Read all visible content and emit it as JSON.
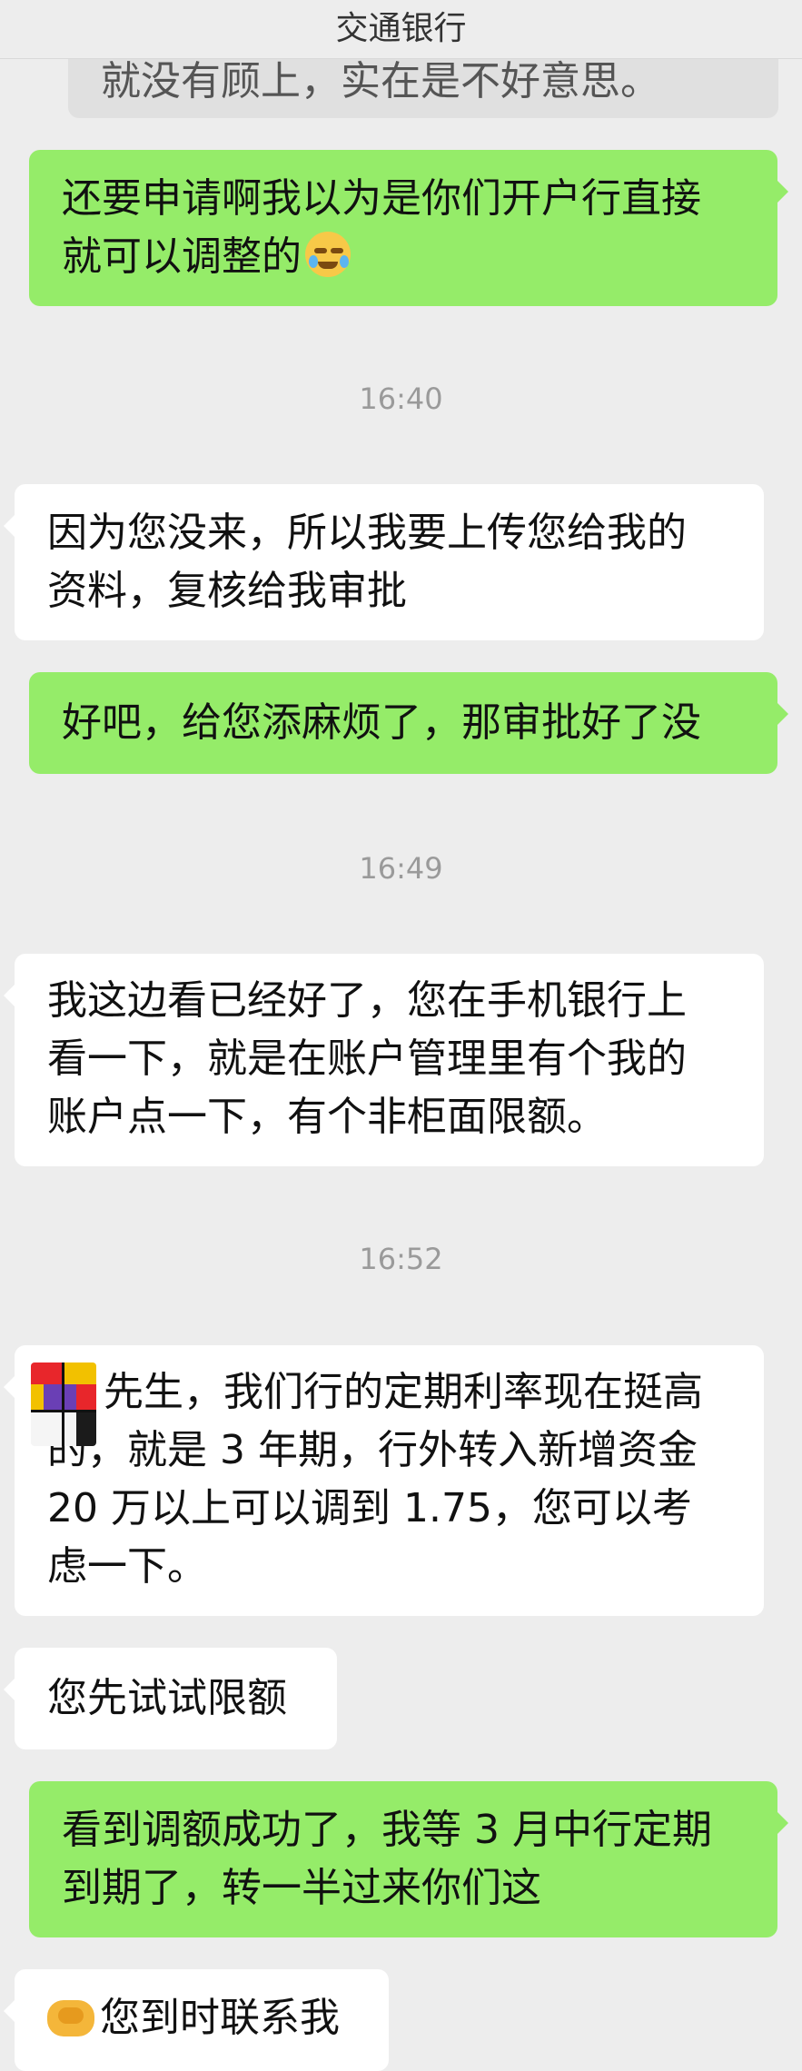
{
  "header": {
    "title": "交通银行"
  },
  "messages": {
    "quoted": {
      "lines": [
        "就没有顾上，实在是不好意思。"
      ]
    },
    "m1": {
      "lines": [
        "还要申请啊我以为是你们开户行直接",
        "就可以调整的"
      ],
      "emoji": "face-with-tears-emoji"
    },
    "t1": "16:40",
    "m2": {
      "lines": [
        "因为您没来，所以我要上传您给我的",
        "资料，复核给我审批"
      ]
    },
    "m3": {
      "lines": [
        "好吧，给您添麻烦了，那审批好了没"
      ]
    },
    "t2": "16:49",
    "m4": {
      "lines": [
        "我这边看已经好了，您在手机银行上",
        "看一下，就是在账户管理里有个我的",
        "账户点一下，有个非柜面限额。"
      ]
    },
    "t3": "16:52",
    "m5": {
      "lines": [
        "先生，我们行的定期利率现在挺高",
        "的，就是 3 年期，行外转入新增资金",
        "20 万以上可以调到 1.75，您可以考",
        "虑一下。"
      ]
    },
    "m6": {
      "lines": [
        "您先试试限额"
      ]
    },
    "m7": {
      "lines": [
        "看到调额成功了，我等 3 月中行定期",
        "到期了，转一半过来你们这"
      ]
    },
    "m8": {
      "lines": [
        "您到时联系我"
      ],
      "emoji": "handshake-emoji"
    }
  },
  "colors": {
    "incoming": "#ffffff",
    "outgoing": "#95ec69",
    "background": "#ededed"
  }
}
